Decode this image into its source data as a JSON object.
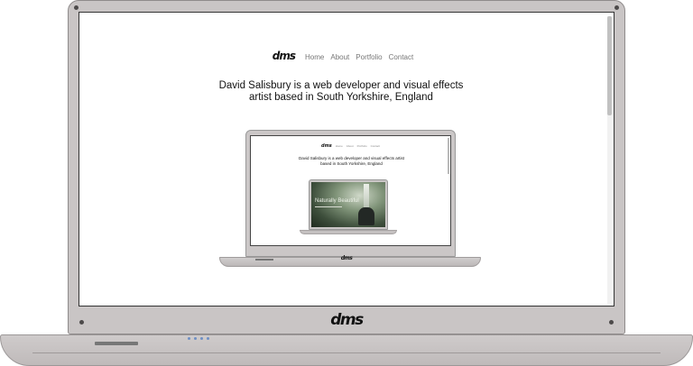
{
  "brand": {
    "logo": "dms"
  },
  "site": {
    "nav": [
      {
        "label": "Home"
      },
      {
        "label": "About"
      },
      {
        "label": "Portfolio"
      },
      {
        "label": "Contact"
      }
    ],
    "headline_line1": "David Salisbury is a web developer and visual effects",
    "headline_line2": "artist based in South Yorkshire, England"
  },
  "nested_site": {
    "headline_line1": "David Salisbury is a web developer and visual effects artist",
    "headline_line2": "based in South Yorkshire, England"
  },
  "inner_preview": {
    "title": "Naturally Beautiful"
  },
  "colors": {
    "laptop_body": "#c9c5c5",
    "text": "#111111",
    "nav_link": "#777777",
    "led": "#6d8fc4"
  },
  "icons": {
    "scrollbar": "vertical-scrollbar",
    "ports": "usb-port"
  }
}
